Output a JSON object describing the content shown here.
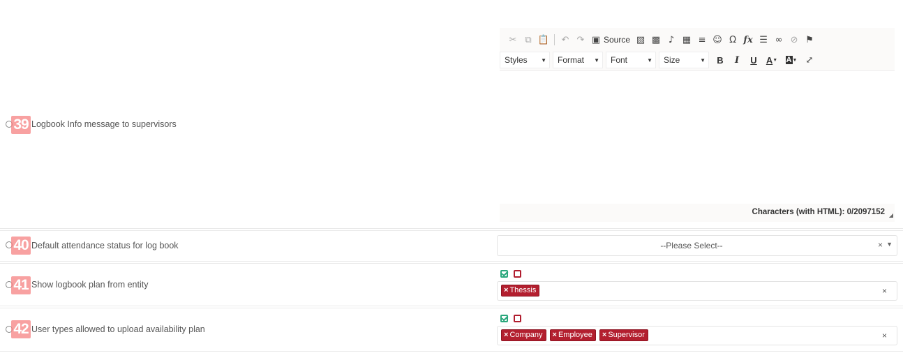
{
  "rows": [
    {
      "number": "39",
      "label": "Logbook Info message to supervisors"
    },
    {
      "number": "40",
      "label": "Default attendance status for log book"
    },
    {
      "number": "41",
      "label": "Show logbook plan from entity"
    },
    {
      "number": "42",
      "label": "User types allowed to upload availability plan"
    }
  ],
  "editor": {
    "toolbar": {
      "source_label": "Source",
      "icons": [
        "cut-icon",
        "copy-icon",
        "paste-icon",
        "undo-icon",
        "redo-icon",
        "source-icon",
        "image-icon",
        "image2-icon",
        "audio-icon",
        "table-icon",
        "horizontal-rule-icon",
        "smiley-icon",
        "special-char-icon",
        "formula-icon",
        "list-icon",
        "link-icon",
        "unlink-icon",
        "anchor-icon"
      ],
      "styles_label": "Styles",
      "format_label": "Format",
      "font_label": "Font",
      "size_label": "Size",
      "bold": "B",
      "italic": "I",
      "underline": "U",
      "text_color": "A",
      "bg_color": "A"
    },
    "char_count": "Characters (with HTML): 0/2097152"
  },
  "attendance_select": {
    "value": "--Please Select--",
    "clear": "×",
    "caret": "▼"
  },
  "logbook_plan": {
    "tags": [
      {
        "remove": "×",
        "label": "Thessis"
      }
    ],
    "clear": "×"
  },
  "availability_plan": {
    "tags": [
      {
        "remove": "×",
        "label": "Company"
      },
      {
        "remove": "×",
        "label": "Employee"
      },
      {
        "remove": "×",
        "label": "Supervisor"
      }
    ],
    "clear": "×"
  },
  "colors": {
    "badge": "#f58282",
    "tag": "#b31f2f",
    "check_all": "#2aa77c",
    "check_none": "#b01c2e"
  }
}
